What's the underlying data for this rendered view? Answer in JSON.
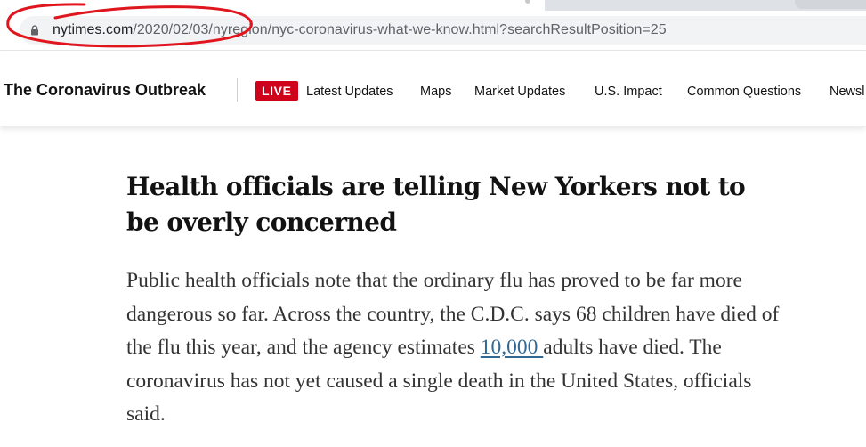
{
  "browser": {
    "url_host": "nytimes.com",
    "url_path": "/2020/02/03/nyregion/nyc-coronavirus-what-we-know.html?searchResultPosition=25"
  },
  "site_nav": {
    "brand": "The Coronavirus Outbreak",
    "live_badge": "LIVE",
    "links": [
      "Latest Updates",
      "Maps",
      "Market Updates",
      "U.S. Impact",
      "Common Questions",
      "Newsl"
    ]
  },
  "article": {
    "headline": "Health officials are telling New Yorkers not to be overly concerned",
    "paragraph_before_link": "Public health officials note that the ordinary flu has proved to be far more dangerous so far. Across the country, the C.D.C. says 68 children have died of the flu this year, and the agency estimates ",
    "link_text": "10,000 ",
    "paragraph_after_link": "adults have died. The coronavirus has not yet caused a single death in the United States, officials said."
  },
  "colors": {
    "live_badge": "#d0021b",
    "link": "#326891",
    "annotation": "#e0161e"
  },
  "icons": {
    "lock": "lock-icon"
  }
}
